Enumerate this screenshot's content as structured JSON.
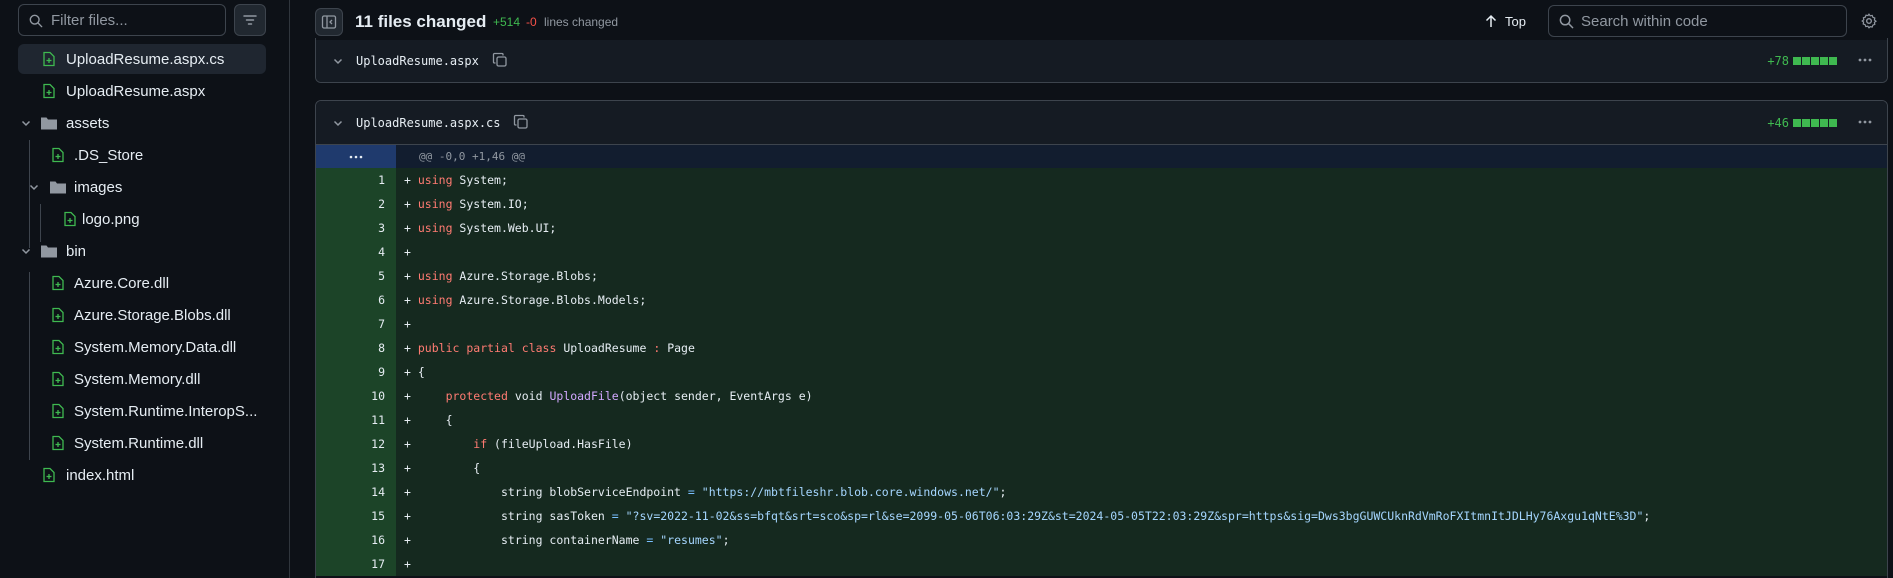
{
  "sidebar": {
    "filter_placeholder": "Filter files...",
    "items": [
      {
        "label": "UploadResume.aspx.cs",
        "type": "file",
        "selected": true
      },
      {
        "label": "UploadResume.aspx",
        "type": "file"
      },
      {
        "label": "assets",
        "type": "folder"
      },
      {
        "label": ".DS_Store",
        "type": "file"
      },
      {
        "label": "images",
        "type": "folder"
      },
      {
        "label": "logo.png",
        "type": "file"
      },
      {
        "label": "bin",
        "type": "folder"
      },
      {
        "label": "Azure.Core.dll",
        "type": "file"
      },
      {
        "label": "Azure.Storage.Blobs.dll",
        "type": "file"
      },
      {
        "label": "System.Memory.Data.dll",
        "type": "file"
      },
      {
        "label": "System.Memory.dll",
        "type": "file"
      },
      {
        "label": "System.Runtime.InteropS...",
        "type": "file"
      },
      {
        "label": "System.Runtime.dll",
        "type": "file"
      },
      {
        "label": "index.html",
        "type": "file"
      }
    ]
  },
  "header": {
    "files_changed": "11 files changed",
    "additions": "+514",
    "deletions": "-0",
    "lines_changed": "lines changed",
    "top_label": "Top",
    "search_placeholder": "Search within code"
  },
  "files": [
    {
      "name": "UploadResume.aspx",
      "stat": "+78"
    },
    {
      "name": "UploadResume.aspx.cs",
      "stat": "+46"
    }
  ],
  "diff": {
    "hunk": "@@ -0,0 +1,46 @@",
    "lines": [
      {
        "n": "1",
        "marker": "+",
        "indent": "",
        "tokens": [
          {
            "c": "k",
            "t": "using"
          },
          {
            "c": "",
            "t": " System;"
          }
        ]
      },
      {
        "n": "2",
        "marker": "+",
        "indent": "",
        "tokens": [
          {
            "c": "k",
            "t": "using"
          },
          {
            "c": "",
            "t": " System.IO;"
          }
        ]
      },
      {
        "n": "3",
        "marker": "+",
        "indent": "",
        "tokens": [
          {
            "c": "k",
            "t": "using"
          },
          {
            "c": "",
            "t": " System.Web.UI;"
          }
        ]
      },
      {
        "n": "4",
        "marker": "+",
        "indent": "",
        "tokens": []
      },
      {
        "n": "5",
        "marker": "+",
        "indent": "",
        "tokens": [
          {
            "c": "k",
            "t": "using"
          },
          {
            "c": "",
            "t": " Azure.Storage.Blobs;"
          }
        ]
      },
      {
        "n": "6",
        "marker": "+",
        "indent": "",
        "tokens": [
          {
            "c": "k",
            "t": "using"
          },
          {
            "c": "",
            "t": " Azure.Storage.Blobs.Models;"
          }
        ]
      },
      {
        "n": "7",
        "marker": "+",
        "indent": "",
        "tokens": []
      },
      {
        "n": "8",
        "marker": "+",
        "indent": "",
        "tokens": [
          {
            "c": "k",
            "t": "public"
          },
          {
            "c": "",
            "t": " "
          },
          {
            "c": "k",
            "t": "partial"
          },
          {
            "c": "",
            "t": " "
          },
          {
            "c": "k",
            "t": "class"
          },
          {
            "c": "",
            "t": " UploadResume "
          },
          {
            "c": "k",
            "t": ":"
          },
          {
            "c": "",
            "t": " Page"
          }
        ]
      },
      {
        "n": "9",
        "marker": "+",
        "indent": "",
        "tokens": [
          {
            "c": "",
            "t": "{"
          }
        ]
      },
      {
        "n": "10",
        "marker": "+",
        "indent": "    ",
        "tokens": [
          {
            "c": "k",
            "t": "protected"
          },
          {
            "c": "",
            "t": " void "
          },
          {
            "c": "f",
            "t": "UploadFile"
          },
          {
            "c": "",
            "t": "(object sender, EventArgs e)"
          }
        ]
      },
      {
        "n": "11",
        "marker": "+",
        "indent": "    ",
        "tokens": [
          {
            "c": "",
            "t": "{"
          }
        ]
      },
      {
        "n": "12",
        "marker": "+",
        "indent": "        ",
        "tokens": [
          {
            "c": "k",
            "t": "if"
          },
          {
            "c": "",
            "t": " (fileUpload.HasFile)"
          }
        ]
      },
      {
        "n": "13",
        "marker": "+",
        "indent": "        ",
        "tokens": [
          {
            "c": "",
            "t": "{"
          }
        ]
      },
      {
        "n": "14",
        "marker": "+",
        "indent": "            ",
        "tokens": [
          {
            "c": "",
            "t": "string blobServiceEndpoint "
          },
          {
            "c": "o",
            "t": "="
          },
          {
            "c": "",
            "t": " "
          },
          {
            "c": "s",
            "t": "\"https://mbtfileshr.blob.core.windows.net/\""
          },
          {
            "c": "",
            "t": ";"
          }
        ]
      },
      {
        "n": "15",
        "marker": "+",
        "indent": "            ",
        "tokens": [
          {
            "c": "",
            "t": "string sasToken "
          },
          {
            "c": "o",
            "t": "="
          },
          {
            "c": "",
            "t": " "
          },
          {
            "c": "s",
            "t": "\"?sv=2022-11-02&ss=bfqt&srt=sco&sp=rl&se=2099-05-06T06:03:29Z&st=2024-05-05T22:03:29Z&spr=https&sig=Dws3bgGUWCUknRdVmRoFXItmnItJDLHy76Axgu1qNtE%3D\""
          },
          {
            "c": "",
            "t": ";"
          }
        ]
      },
      {
        "n": "16",
        "marker": "+",
        "indent": "            ",
        "tokens": [
          {
            "c": "",
            "t": "string containerName "
          },
          {
            "c": "o",
            "t": "="
          },
          {
            "c": "",
            "t": " "
          },
          {
            "c": "s",
            "t": "\"resumes\""
          },
          {
            "c": "",
            "t": ";"
          }
        ]
      },
      {
        "n": "17",
        "marker": "+",
        "indent": "",
        "tokens": []
      }
    ]
  }
}
